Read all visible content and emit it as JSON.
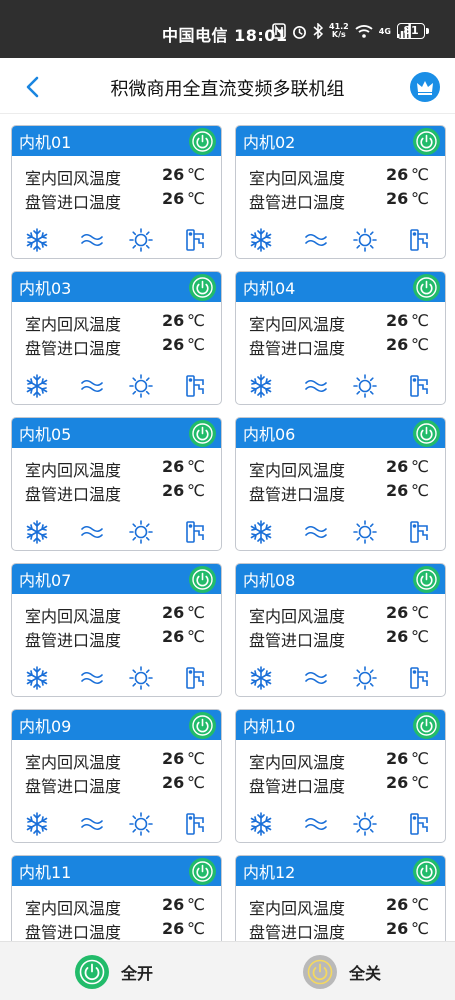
{
  "status_bar": {
    "carrier_time": "中国电信 18:01",
    "net_speed_value": "41.2",
    "net_speed_unit": "K/s",
    "network_type": "4G",
    "battery": "81"
  },
  "header": {
    "title": "积微商用全直流变频多联机组"
  },
  "units": [
    {
      "name": "内机01",
      "return_air_label": "室内回风温度",
      "return_air_value": "26",
      "coil_inlet_label": "盘管进口温度",
      "coil_inlet_value": "26",
      "unit_symbol": "℃"
    },
    {
      "name": "内机02",
      "return_air_label": "室内回风温度",
      "return_air_value": "26",
      "coil_inlet_label": "盘管进口温度",
      "coil_inlet_value": "26",
      "unit_symbol": "℃"
    },
    {
      "name": "内机03",
      "return_air_label": "室内回风温度",
      "return_air_value": "26",
      "coil_inlet_label": "盘管进口温度",
      "coil_inlet_value": "26",
      "unit_symbol": "℃"
    },
    {
      "name": "内机04",
      "return_air_label": "室内回风温度",
      "return_air_value": "26",
      "coil_inlet_label": "盘管进口温度",
      "coil_inlet_value": "26",
      "unit_symbol": "℃"
    },
    {
      "name": "内机05",
      "return_air_label": "室内回风温度",
      "return_air_value": "26",
      "coil_inlet_label": "盘管进口温度",
      "coil_inlet_value": "26",
      "unit_symbol": "℃"
    },
    {
      "name": "内机06",
      "return_air_label": "室内回风温度",
      "return_air_value": "26",
      "coil_inlet_label": "盘管进口温度",
      "coil_inlet_value": "26",
      "unit_symbol": "℃"
    },
    {
      "name": "内机07",
      "return_air_label": "室内回风温度",
      "return_air_value": "26",
      "coil_inlet_label": "盘管进口温度",
      "coil_inlet_value": "26",
      "unit_symbol": "℃"
    },
    {
      "name": "内机08",
      "return_air_label": "室内回风温度",
      "return_air_value": "26",
      "coil_inlet_label": "盘管进口温度",
      "coil_inlet_value": "26",
      "unit_symbol": "℃"
    },
    {
      "name": "内机09",
      "return_air_label": "室内回风温度",
      "return_air_value": "26",
      "coil_inlet_label": "盘管进口温度",
      "coil_inlet_value": "26",
      "unit_symbol": "℃"
    },
    {
      "name": "内机10",
      "return_air_label": "室内回风温度",
      "return_air_value": "26",
      "coil_inlet_label": "盘管进口温度",
      "coil_inlet_value": "26",
      "unit_symbol": "℃"
    },
    {
      "name": "内机11",
      "return_air_label": "室内回风温度",
      "return_air_value": "26",
      "coil_inlet_label": "盘管进口温度",
      "coil_inlet_value": "26",
      "unit_symbol": "℃"
    },
    {
      "name": "内机12",
      "return_air_label": "室内回风温度",
      "return_air_value": "26",
      "coil_inlet_label": "盘管进口温度",
      "coil_inlet_value": "26",
      "unit_symbol": "℃"
    }
  ],
  "mode_icons": [
    "snowflake-icon",
    "wave-icon",
    "sun-icon",
    "drain-icon"
  ],
  "bottom_bar": {
    "all_on_label": "全开",
    "all_off_label": "全关"
  },
  "colors": {
    "card_header": "#1a85e0",
    "power_on": "#22bb6a",
    "power_off": "#b9b9b9",
    "mode_icon": "#1a6fd8",
    "status_bar": "#2f2f2f"
  }
}
